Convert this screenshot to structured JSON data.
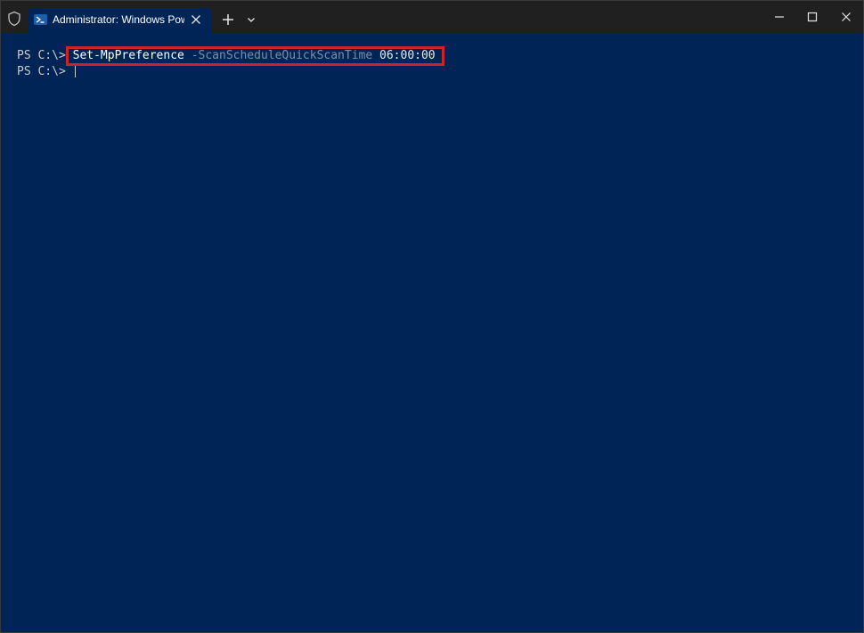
{
  "titlebar": {
    "shield_icon": "shield-icon",
    "tab": {
      "title": "Administrator: Windows Powe",
      "icon": "powershell-icon",
      "close_icon": "close-icon"
    },
    "new_tab_icon": "plus-icon",
    "dropdown_icon": "chevron-down-icon"
  },
  "window_controls": {
    "minimize": "minimize-icon",
    "maximize": "maximize-icon",
    "close": "close-icon"
  },
  "terminal": {
    "lines": [
      {
        "prompt": "PS C:\\> ",
        "cmdlet": "Set-MpPreference",
        "param": "-ScanScheduleQuickScanTime",
        "value": "06:00:00"
      },
      {
        "prompt": "PS C:\\> "
      }
    ]
  },
  "colors": {
    "background": "#012456",
    "titlebar": "#202020",
    "highlight_border": "#d0202a"
  }
}
